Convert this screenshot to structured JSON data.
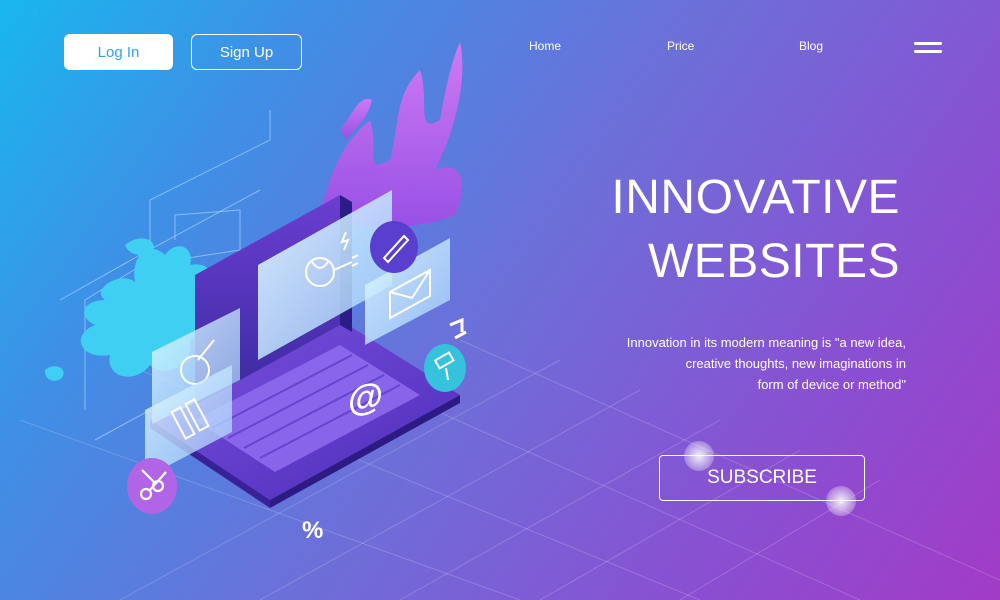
{
  "header": {
    "login_label": "Log In",
    "signup_label": "Sign Up",
    "nav": [
      {
        "label": "Home"
      },
      {
        "label": "Price"
      },
      {
        "label": "Blog"
      }
    ],
    "menu_icon": "hamburger-menu-icon"
  },
  "hero": {
    "title_line1": "INNOVATIVE",
    "title_line2": "WEBSITES",
    "description_line1": "Innovation in its modern meaning is \"a new idea,",
    "description_line2": "creative thoughts, new imaginations in",
    "description_line3": "form of device or method\"",
    "subscribe_label": "SUBSCRIBE"
  },
  "illustration": {
    "at_symbol": "@",
    "percent_symbol": "%",
    "icons": [
      "brain-plug-icon",
      "pencil-icon",
      "envelope-icon",
      "palette-brush-icon",
      "color-swatch-icon",
      "scissors-icon",
      "puzzle-icon",
      "paint-roller-icon"
    ]
  },
  "colors": {
    "gradient_start": "#19b7ef",
    "gradient_mid": "#6d6fd9",
    "gradient_end": "#a23bc6",
    "login_text": "#2ea3ea",
    "laptop_purple": "#6a3fd0",
    "splash_cyan": "#3fd3f3",
    "splash_magenta": "#c86cf2"
  }
}
